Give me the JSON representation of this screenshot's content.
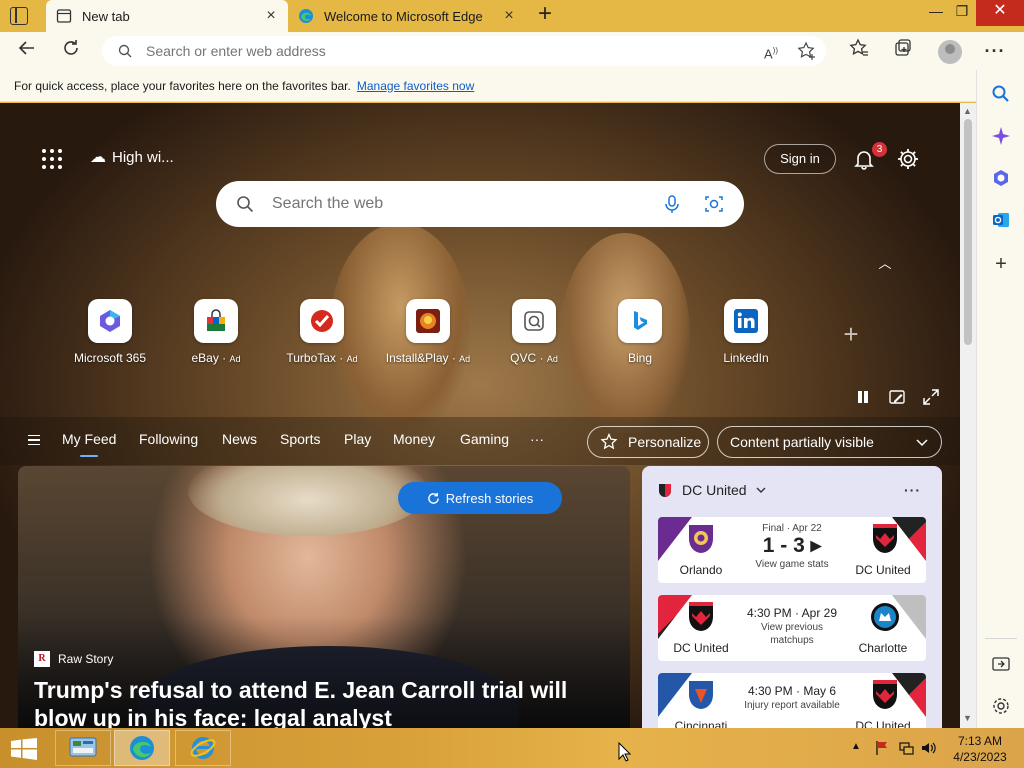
{
  "browser": {
    "tabs": [
      {
        "label": "New tab",
        "active": true
      },
      {
        "label": "Welcome to Microsoft Edge",
        "active": false
      }
    ],
    "window_controls": {
      "minimize": "—",
      "maximize": "❐",
      "close": "✕"
    },
    "address_placeholder": "Search or enter web address",
    "favorites_prompt": "For quick access, place your favorites here on the favorites bar.",
    "favorites_link": "Manage favorites now",
    "accent_color": "#e5b744"
  },
  "newtab": {
    "weather_label": "High wi...",
    "sign_in": "Sign in",
    "notification_count": "3",
    "search_placeholder": "Search the web",
    "quick_links": [
      {
        "name": "Microsoft 365",
        "ad": ""
      },
      {
        "name": "eBay",
        "ad": "Ad"
      },
      {
        "name": "TurboTax",
        "ad": "Ad"
      },
      {
        "name": "Install&Play",
        "ad": "Ad"
      },
      {
        "name": "QVC",
        "ad": "Ad"
      },
      {
        "name": "Bing",
        "ad": ""
      },
      {
        "name": "LinkedIn",
        "ad": ""
      }
    ],
    "feed_nav": [
      "My Feed",
      "Following",
      "News",
      "Sports",
      "Play",
      "Money",
      "Gaming"
    ],
    "nav_more": "···",
    "personalize": "Personalize",
    "content_visibility": "Content partially visible"
  },
  "hero": {
    "refresh": "Refresh stories",
    "source_logo": "R",
    "source": "Raw Story",
    "headline": "Trump's refusal to attend E. Jean Carroll trial will blow up in his face: legal analyst"
  },
  "sports": {
    "team": "DC United",
    "more": "···",
    "matches": [
      {
        "left": "Orlando",
        "right": "DC United",
        "status": "Final · Apr 22",
        "score": "1 - 3 ▸",
        "sub": "View game stats"
      },
      {
        "left": "DC United",
        "right": "Charlotte",
        "time": "4:30 PM · Apr 29",
        "sub": "View previous matchups"
      },
      {
        "left": "Cincinnati",
        "right": "DC United",
        "time": "4:30 PM · May 6",
        "sub": "Injury report available"
      }
    ]
  },
  "taskbar": {
    "time": "7:13 AM",
    "date": "4/23/2023"
  }
}
